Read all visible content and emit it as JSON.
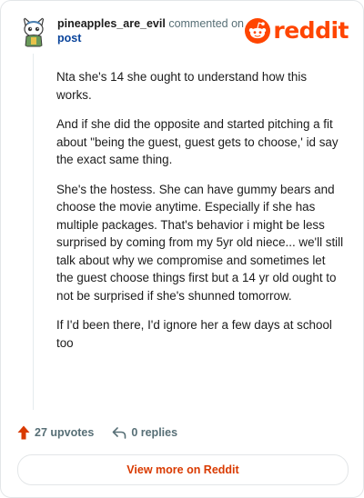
{
  "header": {
    "username": "pineapples_are_evil",
    "commented_text": "commented on",
    "post_link": "post",
    "avatar_icon": "snoo-avatar-icon",
    "brand": {
      "wordmark": "reddit",
      "icon": "reddit-snoo-icon",
      "color": "#FF4500"
    }
  },
  "comment": {
    "paragraphs": [
      "Nta she's 14 she ought to understand how this works.",
      "And if she did the opposite and started pitching a fit about \"being the guest, guest gets to choose,' id say the exact same thing.",
      "She's the hostess. She can have gummy bears and choose the movie anytime. Especially if she has multiple packages. That's behavior i might be less surprised by coming from my 5yr old niece... we'll still talk about why we compromise and sometimes let the guest choose things first but a 14 yr old ought to not be surprised if she's shunned tomorrow.",
      "If I'd been there, I'd ignore her a few days at school too"
    ]
  },
  "actions": {
    "upvotes_label": "27 upvotes",
    "replies_label": "0 replies",
    "upvote_icon": "upvote-arrow-icon",
    "reply_icon": "reply-arrow-icon",
    "upvote_color": "#D93A00"
  },
  "footer": {
    "view_more_label": "View more on Reddit"
  }
}
